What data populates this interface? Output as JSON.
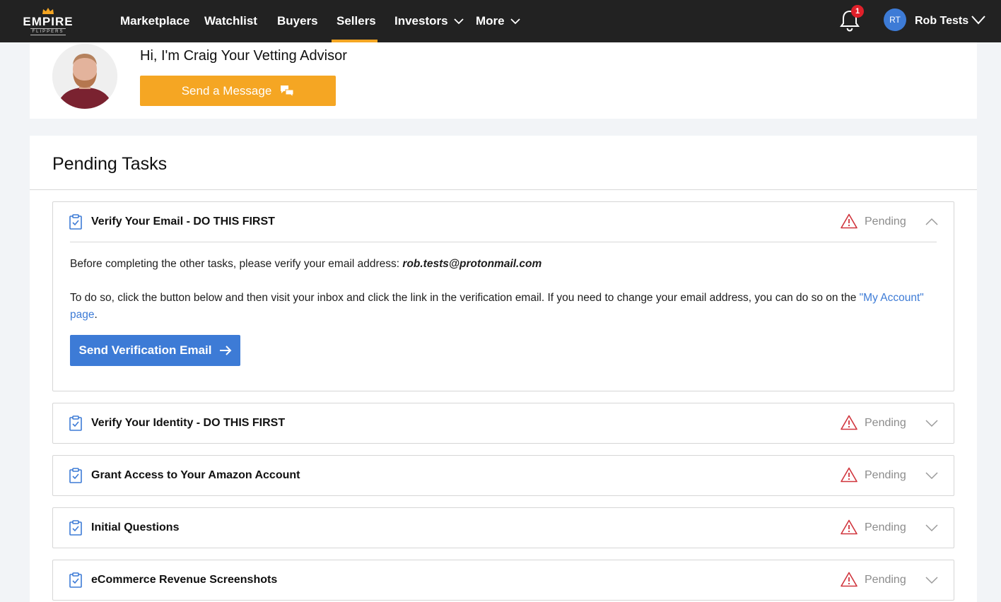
{
  "nav": {
    "logo": {
      "word": "EMPIRE",
      "sub": "FLIPPERS"
    },
    "items": [
      {
        "label": "Marketplace"
      },
      {
        "label": "Watchlist"
      },
      {
        "label": "Buyers"
      },
      {
        "label": "Sellers",
        "active": true
      },
      {
        "label": "Investors",
        "dropdown": true
      },
      {
        "label": "More",
        "dropdown": true
      }
    ],
    "notifications": {
      "count": "1",
      "icon": "bell-icon"
    },
    "user": {
      "initials": "RT",
      "name": "Rob Tests"
    }
  },
  "advisor": {
    "title": "Hi, I'm Craig Your Vetting Advisor",
    "button_label": "Send a Message",
    "button_icon": "chat-bubbles-icon"
  },
  "tasks": {
    "title": "Pending Tasks",
    "items": [
      {
        "name": "Verify Your Email - DO THIS FIRST",
        "status": "Pending",
        "expanded": true,
        "body": {
          "line1_text": "Before completing the other tasks, please verify your email address: ",
          "email": "rob.tests@protonmail.com",
          "line2_text": "To do so, click the button below and then visit your inbox and click the link in the verification email. If you need to change your email address, you can do so on the ",
          "link_text": "\"My Account\" page",
          "line2_end": ".",
          "button_label": "Send Verification Email"
        }
      },
      {
        "name": "Verify Your Identity - DO THIS FIRST",
        "status": "Pending",
        "expanded": false
      },
      {
        "name": "Grant Access to Your Amazon Account",
        "status": "Pending",
        "expanded": false
      },
      {
        "name": "Initial Questions",
        "status": "Pending",
        "expanded": false
      },
      {
        "name": "eCommerce Revenue Screenshots",
        "status": "Pending",
        "expanded": false
      }
    ]
  },
  "colors": {
    "accent_orange": "#f5a623",
    "primary_blue": "#3d7bd6",
    "nav_bg": "#222222",
    "warning_red": "#d0343c",
    "badge_red": "#e0202a"
  }
}
